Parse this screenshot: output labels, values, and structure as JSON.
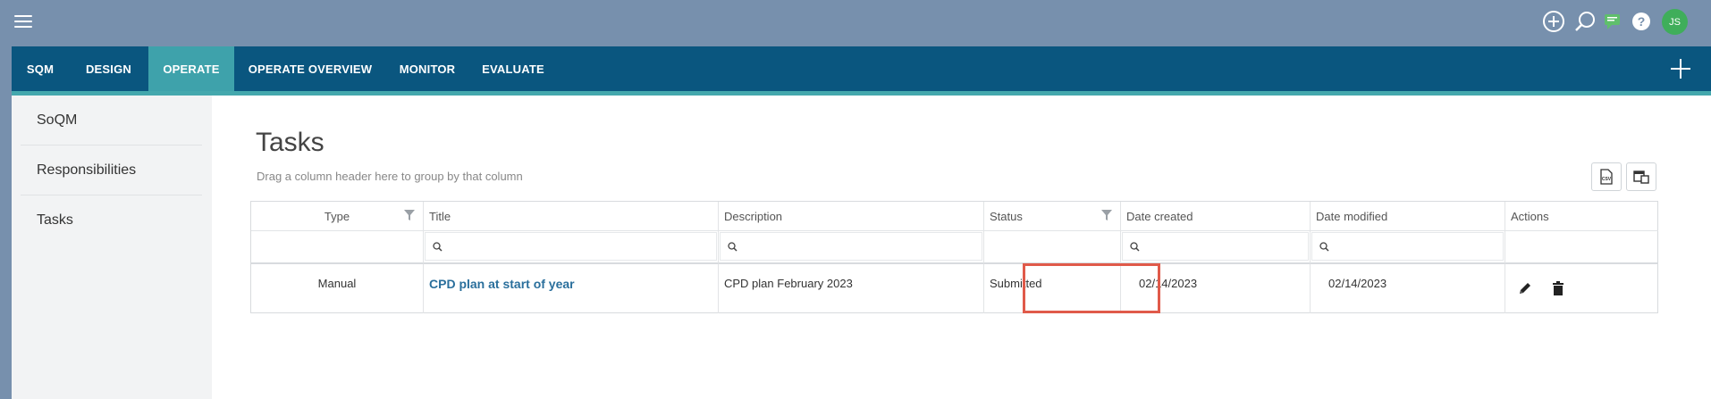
{
  "nav": {
    "tabs": [
      {
        "label": "SQM",
        "active": false
      },
      {
        "label": "DESIGN",
        "active": false
      },
      {
        "label": "OPERATE",
        "active": true
      },
      {
        "label": "OPERATE OVERVIEW",
        "active": false
      },
      {
        "label": "MONITOR",
        "active": false
      },
      {
        "label": "EVALUATE",
        "active": false
      }
    ]
  },
  "user": {
    "initials": "JS"
  },
  "sidebar": {
    "items": [
      {
        "label": "SoQM"
      },
      {
        "label": "Responsibilities"
      },
      {
        "label": "Tasks"
      }
    ]
  },
  "page": {
    "title": "Tasks",
    "group_hint": "Drag a column header here to group by that column"
  },
  "grid": {
    "columns": [
      "Type",
      "Title",
      "Description",
      "Status",
      "Date created",
      "Date modified",
      "Actions"
    ],
    "rows": [
      {
        "type": "Manual",
        "title": "CPD plan at start of year",
        "description": "CPD plan February 2023",
        "status": "Submitted",
        "date_created": "02/14/2023",
        "date_modified": "02/14/2023"
      }
    ]
  },
  "colors": {
    "topbar_bg": "#7790ad",
    "nav_bg": "#0a567f",
    "nav_active": "#3ea2ab",
    "link": "#2a6f9c",
    "highlight": "#e05a4a",
    "avatar": "#3fae5a"
  },
  "icons": {
    "menu": "hamburger-icon",
    "add_circle": "plus-circle-icon",
    "search": "search-icon",
    "chat": "chat-icon",
    "help": "help-icon",
    "add": "plus-icon",
    "filter": "funnel-icon",
    "export_csv": "csv-export-icon",
    "column_chooser": "column-chooser-icon",
    "edit": "pencil-icon",
    "delete": "trash-icon"
  }
}
